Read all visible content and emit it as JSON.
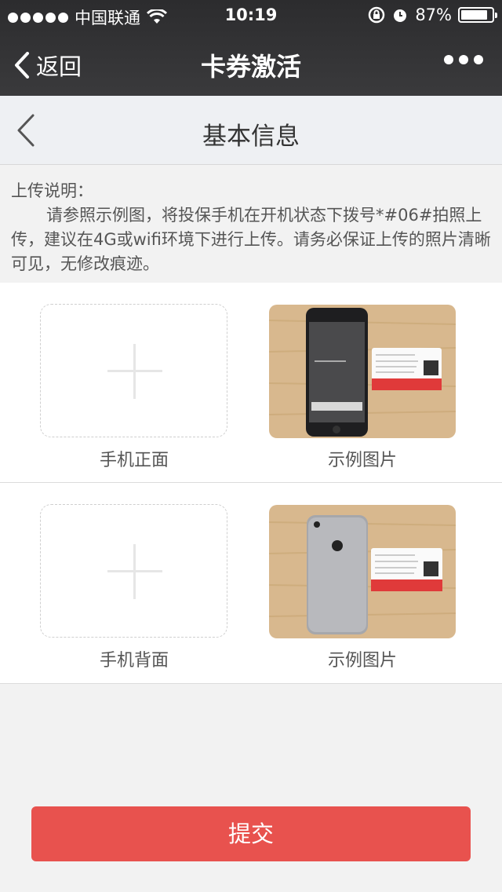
{
  "status": {
    "carrier": "中国联通",
    "time": "10:19",
    "battery": "87%",
    "battery_level": 0.87
  },
  "nav": {
    "back_label": "返回",
    "title": "卡券激活"
  },
  "subheader": {
    "title": "基本信息"
  },
  "notice": {
    "heading": "上传说明：",
    "body": "请参照示例图，将投保手机在开机状态下拨号*#06#拍照上传，建议在4G或wifi环境下进行上传。请务必保证上传的照片清晰可见，无修改痕迹。"
  },
  "uploads": [
    {
      "upload_label": "手机正面",
      "sample_label": "示例图片"
    },
    {
      "upload_label": "手机背面",
      "sample_label": "示例图片"
    }
  ],
  "submit_label": "提交",
  "icons": [
    "back-chevron-icon",
    "wifi-icon",
    "rotation-lock-icon",
    "alarm-icon",
    "battery-icon",
    "more-icon",
    "plus-icon"
  ],
  "colors": {
    "nav_bg": "#2c2c2e",
    "submit": "#e8524e",
    "page_bg": "#f2f2f2"
  }
}
